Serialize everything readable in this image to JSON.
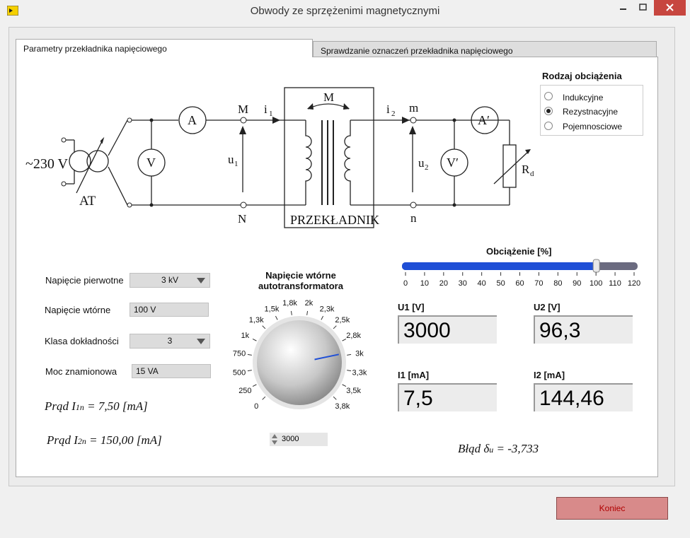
{
  "window": {
    "title": "Obwody ze sprzężenimi magnetycznymi"
  },
  "tabs": [
    {
      "label": "Parametry przekładnika napięciowego"
    },
    {
      "label": "Sprawdzanie oznaczeń przekładnika napięciowego"
    }
  ],
  "diagram": {
    "supply": "~230 V",
    "at": "AT",
    "ammeter": "A",
    "voltmeter": "V",
    "ammeter2": "A′",
    "voltmeter2": "V′",
    "M_top": "M",
    "i1": "i",
    "i1_sub": "1",
    "u1": "u",
    "u1_sub": "1",
    "N": "N",
    "M_mutual": "M",
    "transformer": "PRZEKŁADNIK",
    "i2": "i",
    "i2_sub": "2",
    "m": "m",
    "u2": "u",
    "u2_sub": "2",
    "n": "n",
    "Rd": "R",
    "Rd_sub": "d"
  },
  "load_type": {
    "title": "Rodzaj obciążenia",
    "options": [
      {
        "label": "Indukcyjne",
        "selected": false
      },
      {
        "label": "Rezystnacyjne",
        "selected": true
      },
      {
        "label": "Pojemnosciowe",
        "selected": false
      }
    ]
  },
  "params": {
    "primary_voltage_label": "Napięcie pierwotne",
    "primary_voltage_value": "3 kV",
    "secondary_voltage_label": "Napięcie wtórne",
    "secondary_voltage_value": "100 V",
    "accuracy_label": "Klasa dokładności",
    "accuracy_value": "3",
    "power_label": "Moc znamionowa",
    "power_value": "15 VA"
  },
  "currents": {
    "i1n_prefix": "Prąd I",
    "i1n_sub": "1n",
    "i1n_value": " =  7,50 [mA]",
    "i2n_prefix": "Prąd I",
    "i2n_sub": "2n",
    "i2n_value": " = 150,00 [mA]"
  },
  "knob": {
    "title_line1": "Napięcie wtórne",
    "title_line2": "autotransformatora",
    "ticks": [
      "0",
      "250",
      "500",
      "750",
      "1k",
      "1,3k",
      "1,5k",
      "1,8k",
      "2k",
      "2,3k",
      "2,5k",
      "2,8k",
      "3k",
      "3,3k",
      "3,5k",
      "3,8k"
    ],
    "value": "3000",
    "value_num": 3000,
    "max": 3800
  },
  "load_slider": {
    "label": "Obciążenie [%]",
    "ticks": [
      "0",
      "10",
      "20",
      "30",
      "40",
      "50",
      "60",
      "70",
      "80",
      "90",
      "100",
      "110",
      "120"
    ],
    "value": 100,
    "max": 120
  },
  "readings": {
    "u1_label": "U1 [V]",
    "u1_value": "3000",
    "u2_label": "U2 [V]",
    "u2_value": "96,3",
    "i1_label": "I1 [mA]",
    "i1_value": "7,5",
    "i2_label": "I2 [mA]",
    "i2_value": "144,46"
  },
  "error": {
    "prefix": "Błąd δ",
    "sub": "u",
    "value": " =  -3,733"
  },
  "buttons": {
    "exit": "Koniec"
  },
  "colors": {
    "slider_fill": "#1f4fd6",
    "knob_needle": "#1f4fd6",
    "close_button": "#c7463f",
    "exit_text": "#b00000"
  }
}
